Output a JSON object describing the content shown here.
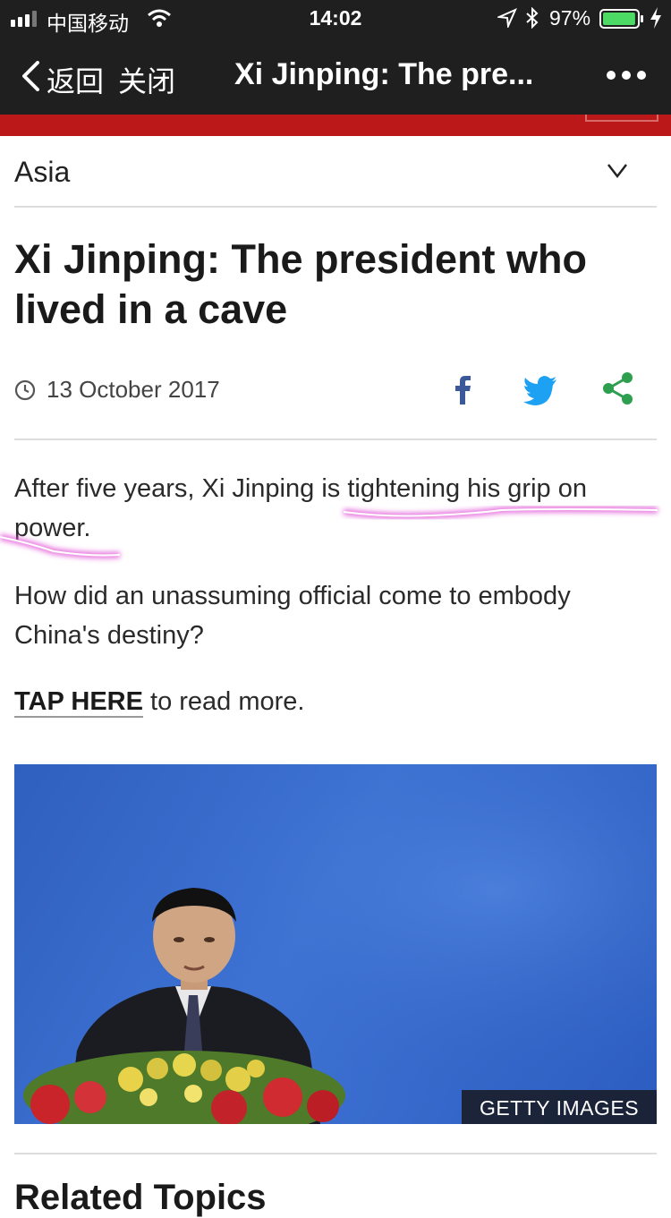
{
  "status_bar": {
    "carrier": "中国移动",
    "time": "14:02",
    "battery_percent": "97%",
    "battery_level": 0.97,
    "icons": [
      "signal-icon",
      "wifi-icon",
      "location-arrow-icon",
      "bluetooth-icon",
      "battery-icon",
      "charging-bolt-icon"
    ]
  },
  "nav_bar": {
    "back_label": "返回",
    "close_label": "关闭",
    "title": "Xi Jinping: The pre...",
    "more_icon": "more-dots-icon"
  },
  "section": {
    "label": "Asia",
    "chevron_icon": "chevron-down-icon"
  },
  "article": {
    "headline": "Xi Jinping: The president who lived in a cave",
    "date": "13 October 2017",
    "share_icons": [
      "facebook-icon",
      "twitter-icon",
      "share-icon"
    ],
    "para1_before": "After five years, Xi Jinping ",
    "para1_highlight": "is tightening his grip on power.",
    "para2": "How did an unassuming official come to embody China's destiny?",
    "tap_link": "TAP HERE",
    "tap_rest": " to read more.",
    "image_credit": "GETTY IMAGES"
  },
  "related": {
    "heading": "Related Topics"
  },
  "colors": {
    "bar_bg": "#1f1f1f",
    "brand_red": "#bb1919",
    "facebook": "#3b5998",
    "twitter": "#1da1f2",
    "share": "#2e9e4f",
    "highlight": "#e04fd6"
  }
}
